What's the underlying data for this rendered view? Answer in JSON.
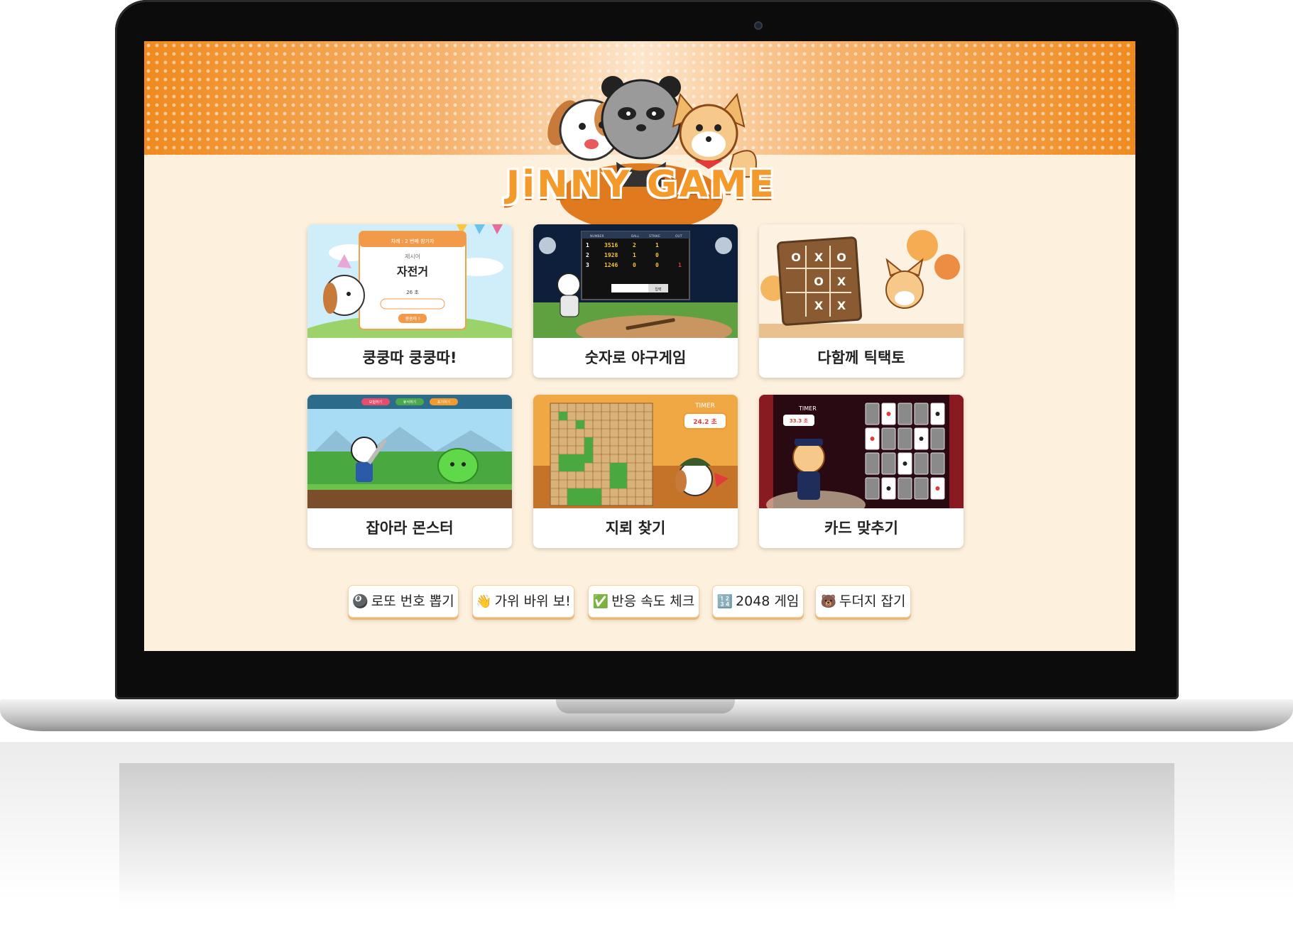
{
  "site": {
    "logo_text": "JiNNY GAME"
  },
  "games": [
    {
      "id": "kungkungtta",
      "title": "쿵쿵따 쿵쿵따!",
      "thumb_texts": {
        "header": "차례 : 2 번째 참가자",
        "label": "제시어",
        "word": "자전거",
        "timer": "26 초",
        "button": "쿵쿵따 !"
      }
    },
    {
      "id": "baseball",
      "title": "숫자로 야구게임",
      "thumb_texts": {
        "columns": [
          "NUMBER",
          "BALL",
          "STRIKE",
          "OUT"
        ],
        "rows": [
          [
            "1",
            "3516",
            "2",
            "1",
            ""
          ],
          [
            "2",
            "1928",
            "1",
            "0",
            ""
          ],
          [
            "3",
            "1246",
            "0",
            "0",
            "1"
          ]
        ],
        "button": "입력"
      }
    },
    {
      "id": "tictactoe",
      "title": "다함께 틱택토"
    },
    {
      "id": "monster",
      "title": "잡아라 몬스터",
      "thumb_texts": {
        "pills": [
          "모험하기",
          "휴식하기",
          "포기하기"
        ]
      }
    },
    {
      "id": "minesweeper",
      "title": "지뢰 찾기",
      "thumb_texts": {
        "timer_label": "TIMER",
        "timer_value": "24.2 초"
      }
    },
    {
      "id": "cards",
      "title": "카드 맞추기",
      "thumb_texts": {
        "timer_label": "TIMER",
        "timer_value": "33.3 초"
      }
    }
  ],
  "extra_games": [
    {
      "icon": "🎱",
      "icon_name": "billiard-ball-icon",
      "label": "로또 번호 뽑기"
    },
    {
      "icon": "👋",
      "icon_name": "waving-hand-icon",
      "label": "가위 바위 보!"
    },
    {
      "icon": "✅",
      "icon_name": "check-mark-icon",
      "label": "반응 속도 체크"
    },
    {
      "icon": "🔢",
      "icon_name": "numbers-icon",
      "label": "2048 게임"
    },
    {
      "icon": "🐻",
      "icon_name": "bear-icon",
      "label": "두더지 잡기"
    }
  ],
  "colors": {
    "accent": "#f39a2a",
    "background": "#fdf0dc",
    "button_shadow": "#eeb574"
  }
}
